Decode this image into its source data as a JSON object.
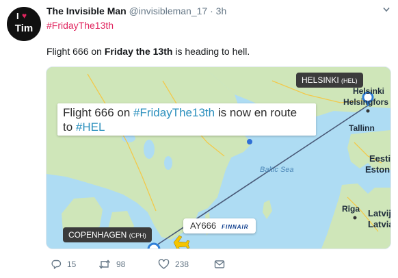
{
  "tweet": {
    "author_name": "The Invisible Man",
    "author_handle": "@invisibleman_17",
    "separator": "·",
    "time": "3h",
    "hashtag": "#FridayThe13th",
    "avatar_text": "Tim",
    "avatar_letter": "I",
    "text_part1": "Flight 666 on ",
    "text_bold": "Friday the 13th",
    "text_part2": " is heading to hell."
  },
  "map": {
    "banner_line1_prefix": "Flight 666 on ",
    "banner_line1_tag": "#FridayThe13th",
    "banner_line1_suffix": " is now en route",
    "banner_line2_prefix": "to ",
    "banner_line2_tag": "#HEL",
    "helsinki_badge": "HELSINKI",
    "helsinki_code": "(HEL)",
    "copenhagen_badge": "COPENHAGEN",
    "copenhagen_code": "(CPH)",
    "flight_code": "AY666",
    "airline_logo": "FINNAIR",
    "labels": {
      "helsinki_fi": "Helsinki",
      "helsingfors": "Helsingfors",
      "tallinn": "Tallinn",
      "estonia": "Eesti",
      "estonia2": "Estonia",
      "baltic_sea": "Baltic Sea",
      "riga": "Rīga",
      "latvia": "Latvija",
      "latvia2": "Latvia"
    }
  },
  "actions": {
    "replies": "15",
    "retweets": "98",
    "likes": "238"
  },
  "colors": {
    "hashtag": "#e0245e",
    "water": "#aedcf3",
    "land": "#cfe6b9",
    "route": "#4a5a78",
    "badge": "#3b3b3b"
  }
}
